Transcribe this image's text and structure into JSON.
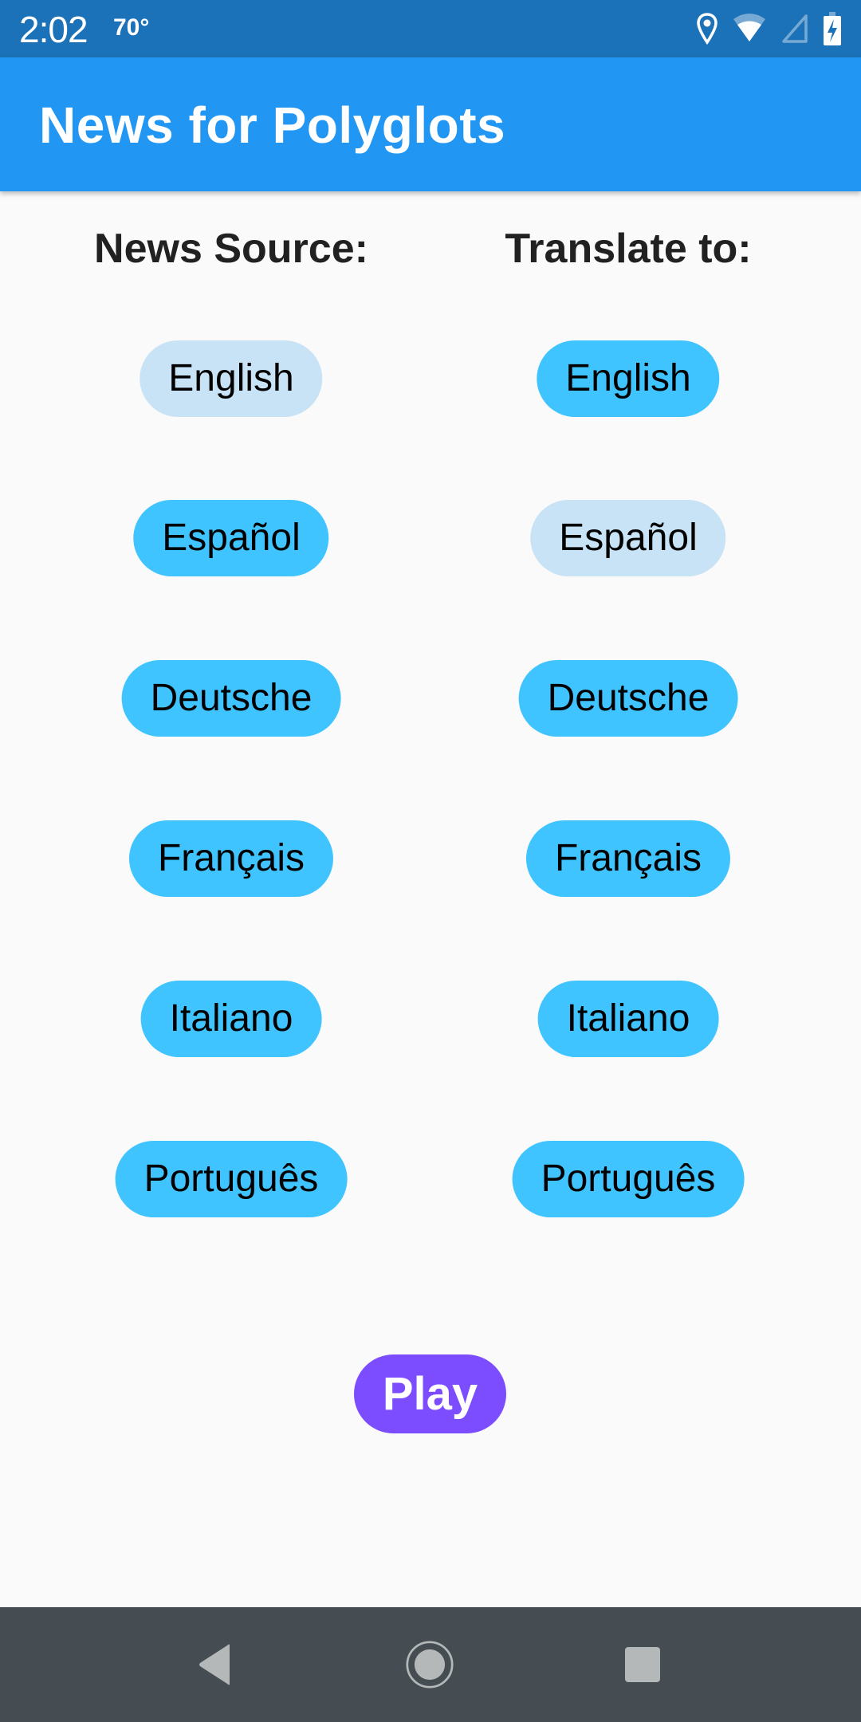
{
  "status_bar": {
    "time": "2:02",
    "temperature": "70°",
    "icons": [
      "location-icon",
      "wifi-icon",
      "cell-signal-icon",
      "battery-charging-icon"
    ]
  },
  "app_bar": {
    "title": "News for Polyglots"
  },
  "source_column": {
    "heading": "News Source:",
    "options": [
      {
        "label": "English",
        "selected": true
      },
      {
        "label": "Español",
        "selected": false
      },
      {
        "label": "Deutsche",
        "selected": false
      },
      {
        "label": "Français",
        "selected": false
      },
      {
        "label": "Italiano",
        "selected": false
      },
      {
        "label": "Português",
        "selected": false
      }
    ]
  },
  "target_column": {
    "heading": "Translate to:",
    "options": [
      {
        "label": "English",
        "selected": false
      },
      {
        "label": "Español",
        "selected": true
      },
      {
        "label": "Deutsche",
        "selected": false
      },
      {
        "label": "Français",
        "selected": false
      },
      {
        "label": "Italiano",
        "selected": false
      },
      {
        "label": "Português",
        "selected": false
      }
    ]
  },
  "play_button": {
    "label": "Play"
  },
  "colors": {
    "status_bar": "#1c72b8",
    "app_bar": "#2196f3",
    "option_default": "#40c4ff",
    "option_selected": "#c8e2f6",
    "play_button": "#7c4dff",
    "nav_bar": "#454c52"
  },
  "nav_bar": {
    "buttons": [
      "back-icon",
      "home-icon",
      "recents-icon"
    ]
  }
}
